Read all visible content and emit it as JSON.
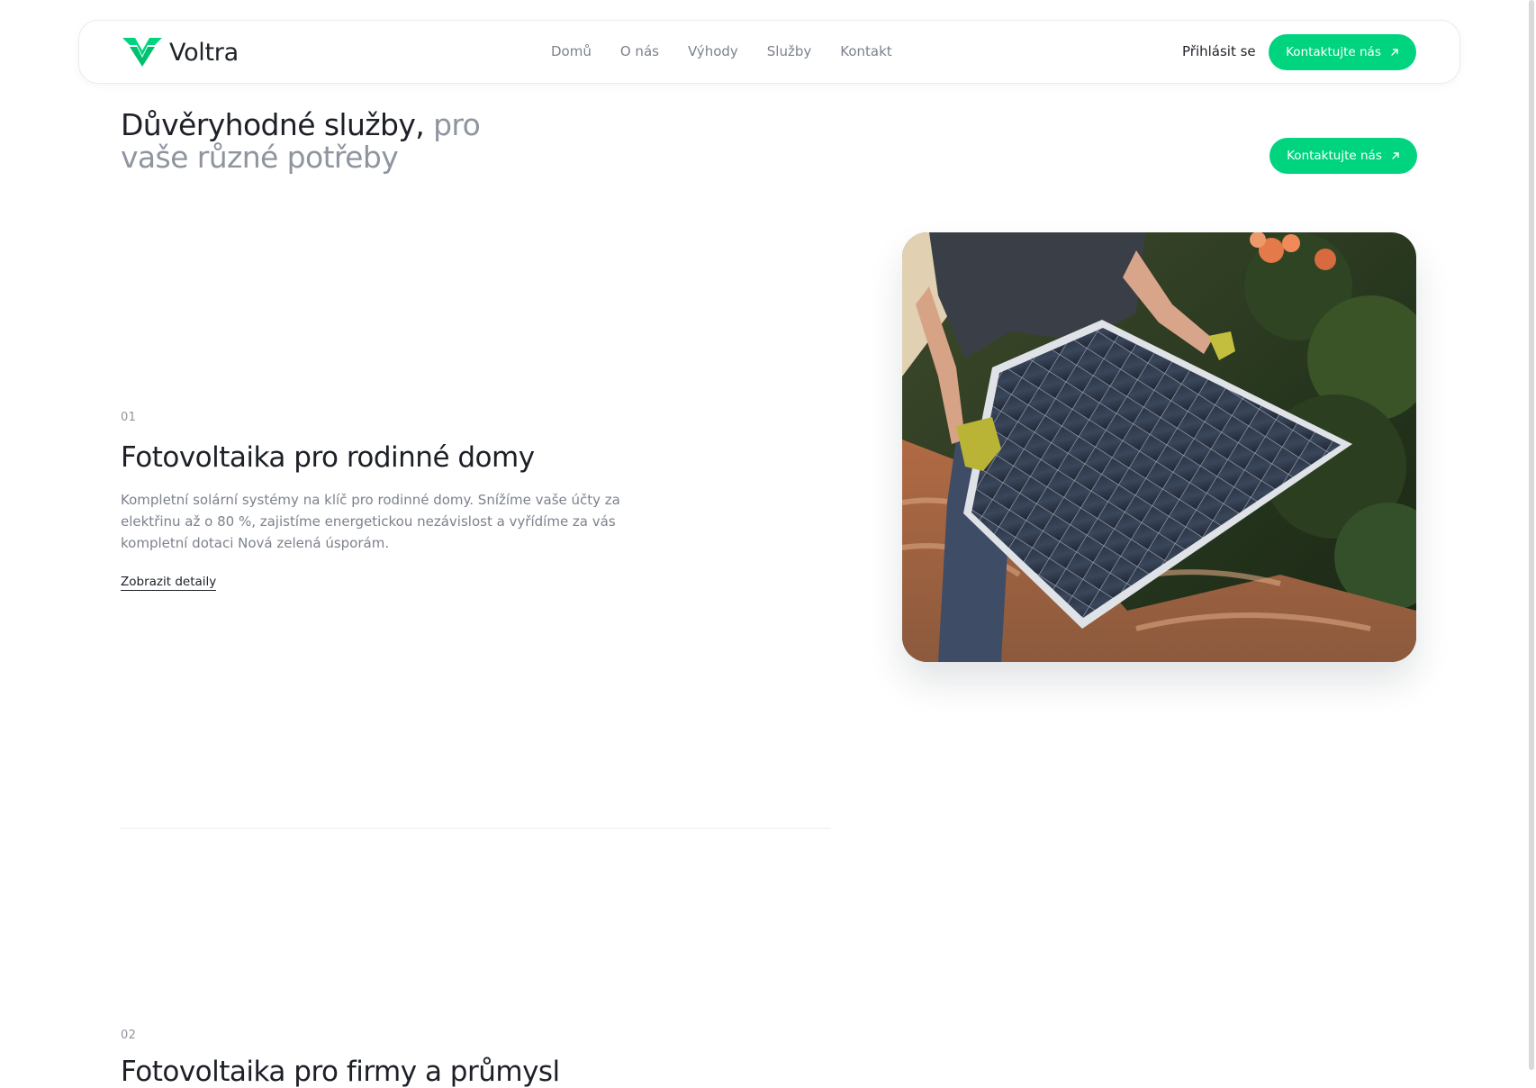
{
  "brand": {
    "name": "Voltra",
    "logo_icon": "voltra-v-icon"
  },
  "nav": {
    "items": [
      {
        "label": "Domů"
      },
      {
        "label": "O nás"
      },
      {
        "label": "Výhody"
      },
      {
        "label": "Služby"
      },
      {
        "label": "Kontakt"
      }
    ],
    "login_label": "Přihlásit se",
    "cta_label": "Kontaktujte nás",
    "cta_icon": "arrow-up-right-icon"
  },
  "services_header": {
    "title_dark": "Důvěryhodné služby,",
    "title_muted": "pro vaše různé potřeby",
    "cta_label": "Kontaktujte nás"
  },
  "services": [
    {
      "number": "01",
      "title": "Fotovoltaika pro rodinné domy",
      "description": "Kompletní solární systémy na klíč pro rodinné domy. Snížíme vaše účty za elektřinu až o 80 %, zajistíme energetickou nezávislost a vyřídíme za vás kompletní dotaci Nová zelená úsporám.",
      "link_label": "Zobrazit detaily",
      "image": "solar-panel-worker-photo"
    },
    {
      "number": "02",
      "title": "Fotovoltaika pro firmy a průmysl"
    }
  ],
  "colors": {
    "accent": "#00d47e",
    "text": "#1d2027",
    "muted": "#8f959f"
  }
}
